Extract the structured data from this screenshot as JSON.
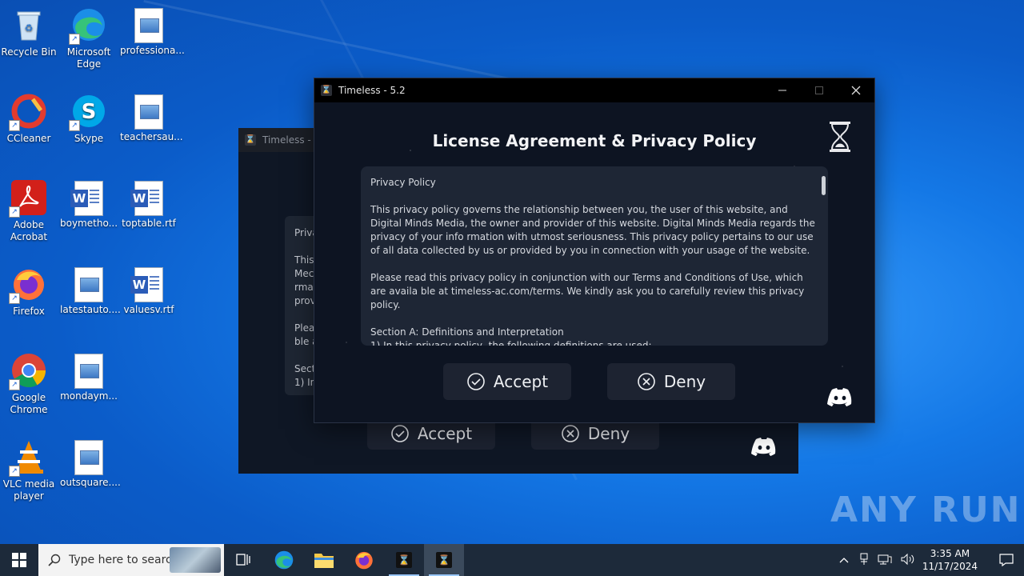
{
  "desktop": {
    "icons": [
      {
        "label": "Recycle Bin"
      },
      {
        "label": "Microsoft Edge"
      },
      {
        "label": "professiona..."
      },
      {
        "label": "CCleaner"
      },
      {
        "label": "Skype"
      },
      {
        "label": "teachersau..."
      },
      {
        "label": "Adobe Acrobat"
      },
      {
        "label": "boymetho..."
      },
      {
        "label": "toptable.rtf"
      },
      {
        "label": "Firefox"
      },
      {
        "label": "latestauto...."
      },
      {
        "label": "valuesv.rtf"
      },
      {
        "label": "Google Chrome"
      },
      {
        "label": "mondaym..."
      },
      {
        "label": "VLC media player"
      },
      {
        "label": "outsquare...."
      }
    ],
    "watermark": "ANY RUN"
  },
  "back_window": {
    "title": "Timeless - 5.",
    "text_lines": [
      "Priva",
      "This",
      "Mec",
      "rmat",
      "prov",
      "Plea",
      "ble a",
      "Sect",
      "1) In"
    ],
    "accept_label": "Accept",
    "deny_label": "Deny"
  },
  "window": {
    "title": "Timeless - 5.2",
    "heading": "License Agreement &  Privacy Policy",
    "paragraphs": [
      "Privacy Policy",
      "This privacy policy governs the relationship between you, the user of this website, and Digital Minds Media, the owner and provider of this website. Digital Minds Media regards the privacy of your info rmation with utmost seriousness. This privacy policy pertains to our use of all data collected by us or provided by you in connection with your usage of the website.",
      "Please read this privacy policy in conjunction with our Terms and Conditions of Use, which are availa ble at timeless-ac.com/terms. We kindly ask you to carefully review this privacy policy.",
      "Section A: Definitions and Interpretation",
      "1) In this privacy policy, the following definitions are used:"
    ],
    "accept_label": "Accept",
    "deny_label": "Deny"
  },
  "taskbar": {
    "search_placeholder": "Type here to search",
    "time": "3:35 AM",
    "date": "11/17/2024"
  },
  "colors": {
    "accent": "#1478e6",
    "window_bg": "#0d1422",
    "panel_bg": "#1e2635"
  }
}
